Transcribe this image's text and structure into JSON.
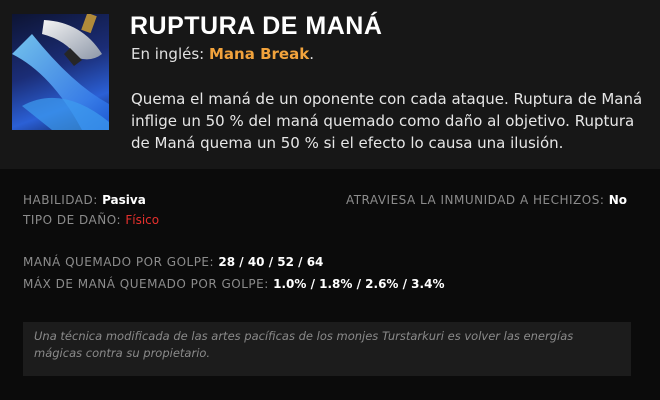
{
  "ability": {
    "icon": "axe-blade-icon",
    "title": "RUPTURA DE MANÁ",
    "english_prefix": "En inglés:",
    "english_name": "Mana Break",
    "english_suffix": ".",
    "description": "Quema el maná de un oponente con cada ataque. Ruptura de Maná inflige un 50 % del maná quemado como daño al objetivo. Ruptura de Maná quema un 50 % si el efecto lo causa una ilusión."
  },
  "stats": {
    "ability_type_label": "HABILIDAD:",
    "ability_type_value": "Pasiva",
    "pierces_immunity_label": "ATRAVIESA LA INMUNIDAD A HECHIZOS:",
    "pierces_immunity_value": "No",
    "damage_type_label": "TIPO DE DAÑO:",
    "damage_type_value": "Físico",
    "mana_burn_label": "MANÁ QUEMADO POR GOLPE:",
    "mana_burn_value": "28 / 40 / 52 / 64",
    "max_mana_burn_label": "MÁX DE MANÁ QUEMADO POR GOLPE:",
    "max_mana_burn_value": "1.0% / 1.8% / 2.6% / 3.4%"
  },
  "lore": "Una técnica modificada de las artes pacíficas de los monjes Turstarkuri es volver las energías mágicas contra su propietario.",
  "colors": {
    "accent_orange": "#f2a33c",
    "physical_red": "#e5302d",
    "header_bg": "#171717",
    "body_bg": "#0b0b0b"
  }
}
